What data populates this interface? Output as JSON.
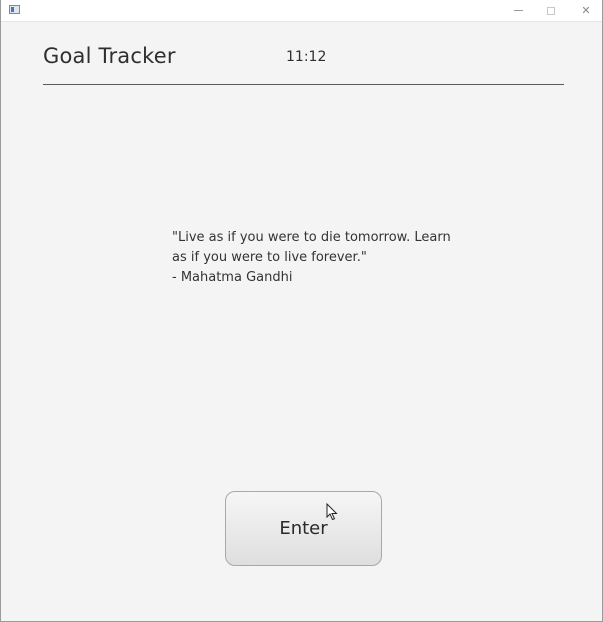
{
  "window": {
    "controls": {
      "minimize_icon": "minimize-icon",
      "maximize_icon": "maximize-icon",
      "close_icon": "close-icon",
      "close_glyph": "✕"
    }
  },
  "header": {
    "title": "Goal Tracker",
    "time": "11:12"
  },
  "quote": {
    "line1": "\"Live as if you were to die tomorrow. Learn",
    "line2": "as if you were to live forever.\"",
    "author": "- Mahatma Gandhi"
  },
  "actions": {
    "enter_label": "Enter"
  },
  "colors": {
    "background": "#f4f4f4",
    "divider": "#5a5a5a",
    "button_border": "#a8a8a8"
  }
}
